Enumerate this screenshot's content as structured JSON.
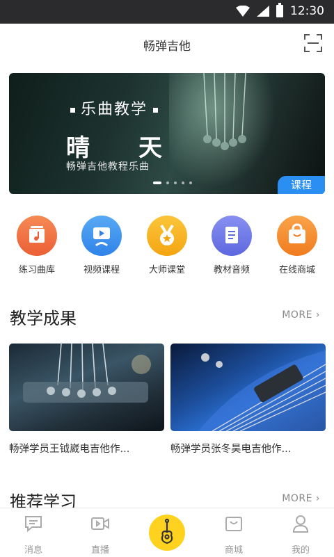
{
  "status_bar": {
    "time": "12:30",
    "icons": [
      "wifi-icon",
      "signal-icon",
      "battery-icon"
    ]
  },
  "header": {
    "title": "畅弹吉他",
    "scan_icon": "scan-icon"
  },
  "banner": {
    "tagline": "乐曲教学",
    "song": "晴天",
    "subtitle": "畅弹吉他教程乐曲",
    "badge": "课程",
    "pages": 5,
    "active_page": 1
  },
  "quick_menu": [
    {
      "label": "练习曲库",
      "icon": "music-library-icon",
      "color": "#f0703f"
    },
    {
      "label": "视频课程",
      "icon": "video-course-icon",
      "color": "#3d95f0"
    },
    {
      "label": "大师课堂",
      "icon": "medal-icon",
      "color": "#f7b21b"
    },
    {
      "label": "教材音频",
      "icon": "document-icon",
      "color": "#6e78e8"
    },
    {
      "label": "在线商城",
      "icon": "shopping-bag-icon",
      "color": "#f48a2a"
    }
  ],
  "results_section": {
    "title": "教学成果",
    "more": "MORE",
    "cards": [
      {
        "caption": "畅弹学员王钺崴电吉他作..."
      },
      {
        "caption": "畅弹学员张冬昊电吉他作..."
      }
    ]
  },
  "recommend_section": {
    "title": "推荐学习",
    "more": "MORE"
  },
  "tab_bar": [
    {
      "label": "消息",
      "icon": "message-icon"
    },
    {
      "label": "直播",
      "icon": "live-video-icon"
    },
    {
      "label": "",
      "icon": "guitar-logo-icon"
    },
    {
      "label": "商城",
      "icon": "shop-icon"
    },
    {
      "label": "我的",
      "icon": "profile-icon"
    }
  ],
  "colors": {
    "accent_blue": "#2a8ef2",
    "center_button": "#ffd21f"
  }
}
